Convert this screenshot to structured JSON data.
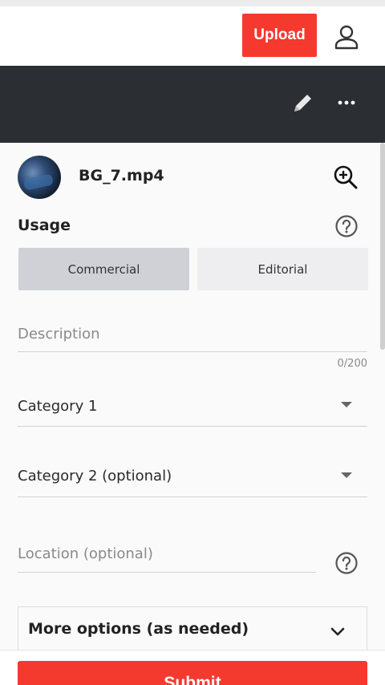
{
  "header": {
    "upload_label": "Upload",
    "user_icon": "user-icon",
    "accent_color": "#f4392f"
  },
  "toolbar": {
    "edit_icon": "pencil-icon",
    "more_icon": "more-vertical-dots-icon",
    "background": "#2b2e33"
  },
  "file": {
    "name": "BG_7.mp4",
    "zoom_icon": "zoom-in-icon"
  },
  "usage": {
    "label": "Usage",
    "help_icon": "help-icon",
    "options": [
      "Commercial",
      "Editorial"
    ],
    "selected": "Commercial"
  },
  "form": {
    "description": {
      "placeholder": "Description",
      "counter": "0/200"
    },
    "category1": {
      "value": "Category 1"
    },
    "category2": {
      "value": "Category 2 (optional)"
    },
    "location": {
      "placeholder": "Location (optional)"
    }
  },
  "more_options": {
    "label": "More options (as needed)"
  },
  "submit": {
    "label": "Submit"
  }
}
